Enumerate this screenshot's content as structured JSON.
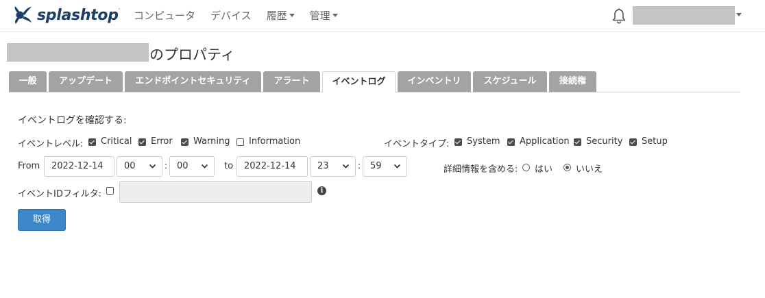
{
  "nav": {
    "logo_text": "splashtop",
    "logo_mark": "·",
    "items": [
      {
        "label": "コンピュータ",
        "dropdown": false
      },
      {
        "label": "デバイス",
        "dropdown": false
      },
      {
        "label": "履歴",
        "dropdown": true
      },
      {
        "label": "管理",
        "dropdown": true
      }
    ],
    "bell_icon": "bell-icon"
  },
  "page": {
    "title_suffix": "のプロパティ"
  },
  "tabs": [
    {
      "label": "一般",
      "active": false
    },
    {
      "label": "アップデート",
      "active": false
    },
    {
      "label": "エンドポイントセキュリティ",
      "active": false
    },
    {
      "label": "アラート",
      "active": false
    },
    {
      "label": "イベントログ",
      "active": true
    },
    {
      "label": "インベントリ",
      "active": false
    },
    {
      "label": "スケジュール",
      "active": false
    },
    {
      "label": "接続権",
      "active": false
    }
  ],
  "form": {
    "heading": "イベントログを確認する:",
    "event_level_label": "イベントレベル:",
    "event_levels": [
      {
        "label": "Critical",
        "checked": true
      },
      {
        "label": "Error",
        "checked": true
      },
      {
        "label": "Warning",
        "checked": true
      },
      {
        "label": "Information",
        "checked": false
      }
    ],
    "event_type_label": "イベントタイプ:",
    "event_types": [
      {
        "label": "System",
        "checked": true
      },
      {
        "label": "Application",
        "checked": true
      },
      {
        "label": "Security",
        "checked": true
      },
      {
        "label": "Setup",
        "checked": true
      }
    ],
    "from_label": "From",
    "from_date": "2022-12-14",
    "from_hour": "00",
    "from_minute": "00",
    "time_sep": ":",
    "to_label": "to",
    "to_date": "2022-12-14",
    "to_hour": "23",
    "to_minute": "59",
    "details_label": "詳細情報を含める:",
    "details_options": [
      {
        "label": "はい",
        "selected": false
      },
      {
        "label": "いいえ",
        "selected": true
      }
    ],
    "event_id_filter_label": "イベントIDフィルタ:",
    "event_id_filter_checked": false,
    "event_id_value": "",
    "info_glyph": "i",
    "submit_label": "取得"
  },
  "colors": {
    "primary": "#3b87c8",
    "tab_inactive": "#a3a3a3",
    "logo": "#1b3e66"
  }
}
